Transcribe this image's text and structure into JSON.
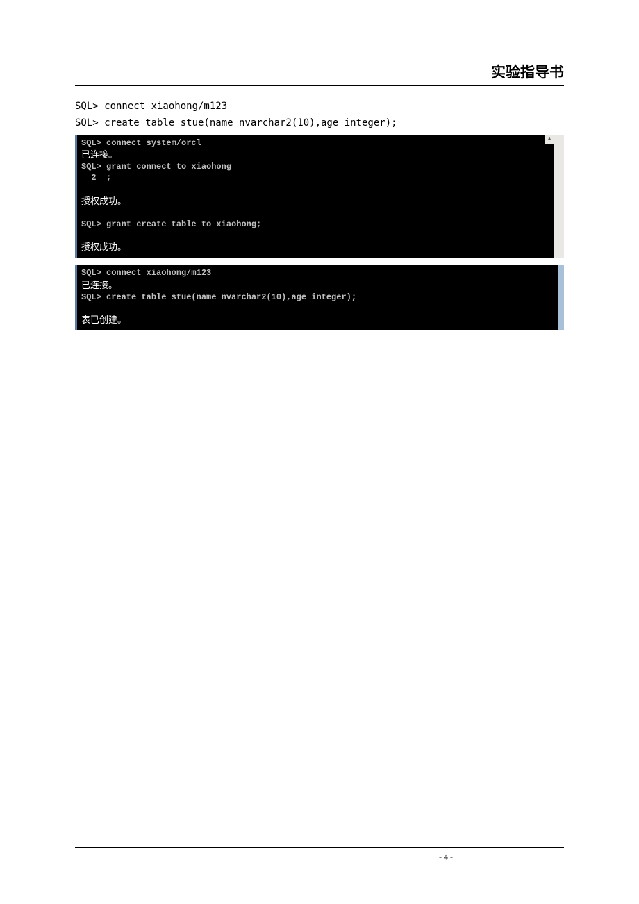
{
  "header": {
    "title": "实验指导书"
  },
  "body": {
    "line1": "SQL> connect xiaohong/m123",
    "line2": "SQL> create table stue(name nvarchar2(10),age integer);"
  },
  "terminal1": {
    "l1": "SQL> connect system/orcl",
    "l2": "已连接。",
    "l3": "SQL> grant connect to xiaohong",
    "l4": "  2  ;",
    "l5": "",
    "l6": "授权成功。",
    "l7": "",
    "l8": "SQL> grant create table to xiaohong;",
    "l9": "",
    "l10": "授权成功。",
    "scroll_up": "▲"
  },
  "terminal2": {
    "l1": "SQL> connect xiaohong/m123",
    "l2": "已连接。",
    "l3": "SQL> create table stue(name nvarchar2(10),age integer);",
    "l4": "",
    "l5": "表已创建。"
  },
  "footer": {
    "page": "- 4 -"
  }
}
